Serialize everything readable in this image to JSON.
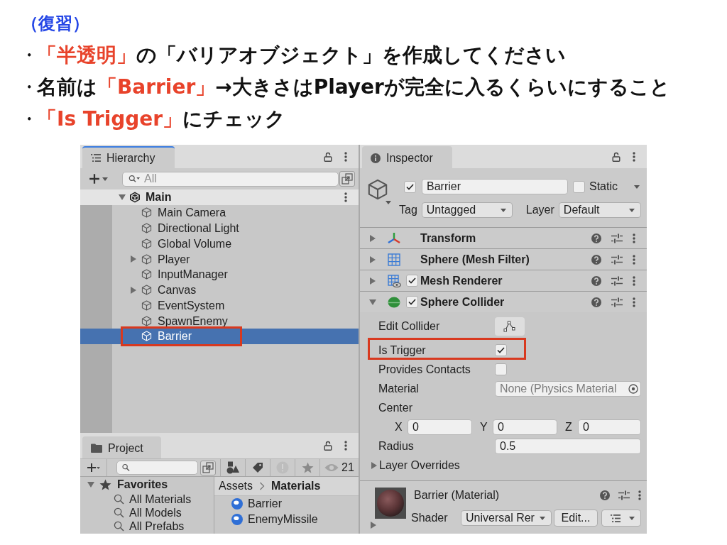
{
  "slide": {
    "heading": "（復習）",
    "bullets": [
      {
        "marker": "・",
        "segments": [
          {
            "text": "「半透明」",
            "highlight": true
          },
          {
            "text": "の「バリアオブジェクト」を作成してください",
            "highlight": false
          }
        ]
      },
      {
        "marker": "・",
        "segments": [
          {
            "text": "名前は",
            "highlight": false
          },
          {
            "text": "「Barrier」",
            "highlight": true
          },
          {
            "text": "→大きさはPlayerが完全に入るくらいにすること",
            "highlight": false
          }
        ]
      },
      {
        "marker": "・",
        "segments": [
          {
            "text": "「Is Trigger」",
            "highlight": true
          },
          {
            "text": "にチェック",
            "highlight": false
          }
        ]
      }
    ]
  },
  "hierarchy": {
    "tab": {
      "title": "Hierarchy",
      "focused": true
    },
    "search": {
      "placeholder": "All"
    },
    "scene": {
      "name": "Main",
      "expanded": true
    },
    "items": [
      {
        "name": "Main Camera",
        "has_children": false,
        "selected": false,
        "highlighted": false
      },
      {
        "name": "Directional Light",
        "has_children": false,
        "selected": false,
        "highlighted": false
      },
      {
        "name": "Global Volume",
        "has_children": false,
        "selected": false,
        "highlighted": false
      },
      {
        "name": "Player",
        "has_children": true,
        "selected": false,
        "highlighted": false
      },
      {
        "name": "InputManager",
        "has_children": false,
        "selected": false,
        "highlighted": false
      },
      {
        "name": "Canvas",
        "has_children": true,
        "selected": false,
        "highlighted": false
      },
      {
        "name": "EventSystem",
        "has_children": false,
        "selected": false,
        "highlighted": false
      },
      {
        "name": "SpawnEnemy",
        "has_children": false,
        "selected": false,
        "highlighted": false
      },
      {
        "name": "Barrier",
        "has_children": false,
        "selected": true,
        "highlighted": true
      }
    ]
  },
  "project": {
    "tab": {
      "title": "Project",
      "focused": false
    },
    "visible_count": "21",
    "favorites": {
      "title": "Favorites",
      "expanded": true,
      "items": [
        {
          "name": "All Materials"
        },
        {
          "name": "All Models"
        },
        {
          "name": "All Prefabs"
        }
      ]
    },
    "breadcrumb": [
      "Assets",
      "Materials"
    ],
    "assets": [
      {
        "name": "Barrier"
      },
      {
        "name": "EnemyMissile"
      }
    ]
  },
  "inspector": {
    "tab": {
      "title": "Inspector",
      "focused": false
    },
    "object": {
      "active": true,
      "name": "Barrier",
      "static": false,
      "static_label": "Static",
      "tag_label": "Tag",
      "tag": "Untagged",
      "layer_label": "Layer",
      "layer": "Default"
    },
    "components": [
      {
        "name": "Transform",
        "kind": "transform",
        "expanded": false
      },
      {
        "name": "Sphere (Mesh Filter)",
        "kind": "mesh_filter",
        "expanded": false
      },
      {
        "name": "Mesh Renderer",
        "kind": "mesh_renderer",
        "enabled": true,
        "expanded": false
      },
      {
        "name": "Sphere Collider",
        "kind": "sphere_collider",
        "enabled": true,
        "expanded": true,
        "properties": [
          {
            "kind": "button",
            "label": "Edit Collider",
            "highlighted": false
          },
          {
            "kind": "checkbox",
            "label": "Is Trigger",
            "checked": true,
            "highlighted": true
          },
          {
            "kind": "checkbox",
            "label": "Provides Contacts",
            "checked": false,
            "highlighted": false
          },
          {
            "kind": "object",
            "label": "Material",
            "value": "None (Physics Material",
            "highlighted": false
          },
          {
            "kind": "vector",
            "label": "Center",
            "axes": [
              {
                "axis": "X",
                "value": "0"
              },
              {
                "axis": "Y",
                "value": "0"
              },
              {
                "axis": "Z",
                "value": "0"
              }
            ],
            "highlighted": false
          },
          {
            "kind": "number",
            "label": "Radius",
            "value": "0.5",
            "highlighted": false
          },
          {
            "kind": "foldout",
            "label": "Layer Overrides",
            "expanded": false,
            "highlighted": false
          }
        ]
      }
    ],
    "material": {
      "name": "Barrier (Material)",
      "shader_label": "Shader",
      "shader": "Universal Rer",
      "edit_button": "Edit...",
      "expanded": false
    }
  }
}
